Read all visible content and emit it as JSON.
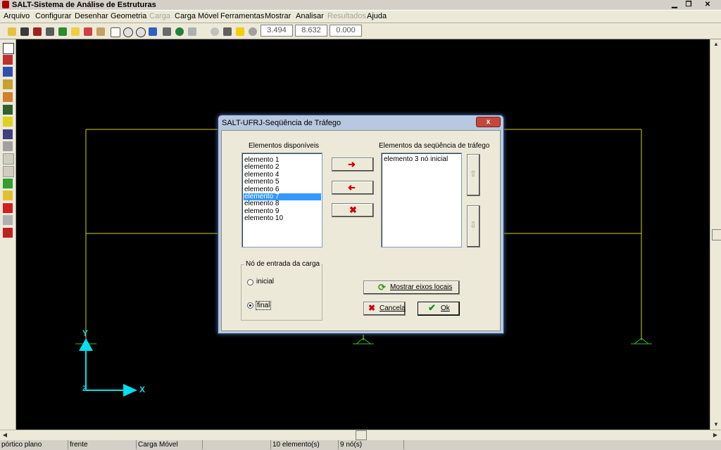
{
  "window": {
    "title": "SALT-Sistema de Análise de Estruturas",
    "minimize": "▁",
    "restore": "❐",
    "close": "✕"
  },
  "menu": {
    "items": [
      {
        "label": "Arquivo",
        "enabled": true
      },
      {
        "label": "Configurar",
        "enabled": true
      },
      {
        "label": "Desenhar",
        "enabled": true
      },
      {
        "label": "Geometria",
        "enabled": true
      },
      {
        "label": "Carga",
        "enabled": false
      },
      {
        "label": "Carga Móvel",
        "enabled": true
      },
      {
        "label": "Ferramentas",
        "enabled": true
      },
      {
        "label": "Mostrar",
        "enabled": true
      },
      {
        "label": "Analisar",
        "enabled": true
      },
      {
        "label": "Resultados",
        "enabled": false
      },
      {
        "label": "Ajuda",
        "enabled": true
      }
    ]
  },
  "toolbar": {
    "coord_x": "3.494",
    "coord_y": "8.632",
    "coord_z": "0.000"
  },
  "canvas": {
    "background": "#000000",
    "frame_color": "#d4d400",
    "axes_color": "#00e0f0",
    "axis_y_label": "Y",
    "axis_x_label": "X",
    "axis_z_label": "Z"
  },
  "dialog": {
    "title": "SALT-UFRJ-Seqüência de Tráfego",
    "close_label": "x",
    "available_label": "Elementos disponíveis",
    "available_items": [
      "elemento 1",
      "elemento 2",
      "elemento 4",
      "elemento 5",
      "elemento 6",
      "elemento 7",
      "elemento 8",
      "elemento 9",
      "elemento 10"
    ],
    "selected_index": 5,
    "sequence_label": "Elementos da seqüência de tráfego",
    "sequence_items": [
      "elemento 3 nó inicial"
    ],
    "load_node_group_label": "Nó de entrada da carga",
    "radio_initial_label": "inicial",
    "radio_final_label": "final",
    "radio_selected": "final",
    "show_axes_button": "Mostrar eixos locais",
    "cancel_button": "Cancela",
    "ok_button": "Ok"
  },
  "status": {
    "cells": [
      "pórtico plano",
      "frente",
      "Carga Móvel",
      "",
      "10 elemento(s)",
      "9 nó(s)"
    ]
  }
}
